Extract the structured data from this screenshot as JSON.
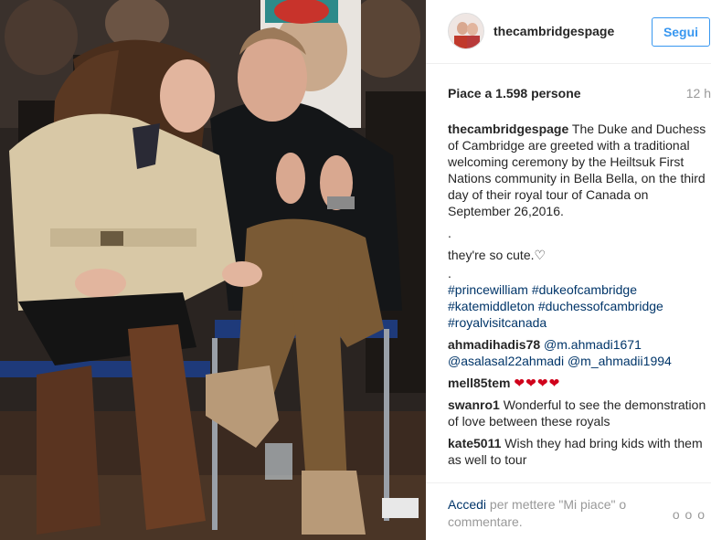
{
  "post": {
    "username": "thecambridgespage",
    "follow_label": "Segui",
    "likes_text": "Piace a 1.598 persone",
    "time_ago": "12 h"
  },
  "caption": {
    "username": "thecambridgespage",
    "text": "The Duke and Duchess of Cambridge are greeted with a traditional welcoming ceremony by the Heiltsuk First Nations community in Bella Bella, on the third day of their royal tour of Canada on September 26,2016.",
    "dot1": ".",
    "line2": "they're so cute.♡",
    "dot2": ".",
    "hashtags": [
      "#princewilliam",
      "#dukeofcambridge",
      "#katemiddleton",
      "#duchessofcambridge",
      "#royalvisitcanada"
    ]
  },
  "comments": [
    {
      "username": "ahmadihadis78",
      "mentions": [
        "@m.ahmadi1671",
        "@asalasal22ahmadi",
        "@m_ahmadii1994"
      ]
    },
    {
      "username": "mell85tem",
      "text": "❤❤❤❤"
    },
    {
      "username": "swanro1",
      "text": "Wonderful to see the demonstration of love between these royals"
    },
    {
      "username": "kate5011",
      "text": "Wish they had bring kids with them as well to tour"
    }
  ],
  "footer": {
    "login_link": "Accedi",
    "login_rest": "per mettere \"Mi piace\" o commentare.",
    "more": "o o o"
  },
  "colors": {
    "link": "#003569",
    "button_blue": "#3897f0",
    "muted": "#999999",
    "heart": "#d0021b"
  },
  "icons": [
    "more-options-icon"
  ]
}
